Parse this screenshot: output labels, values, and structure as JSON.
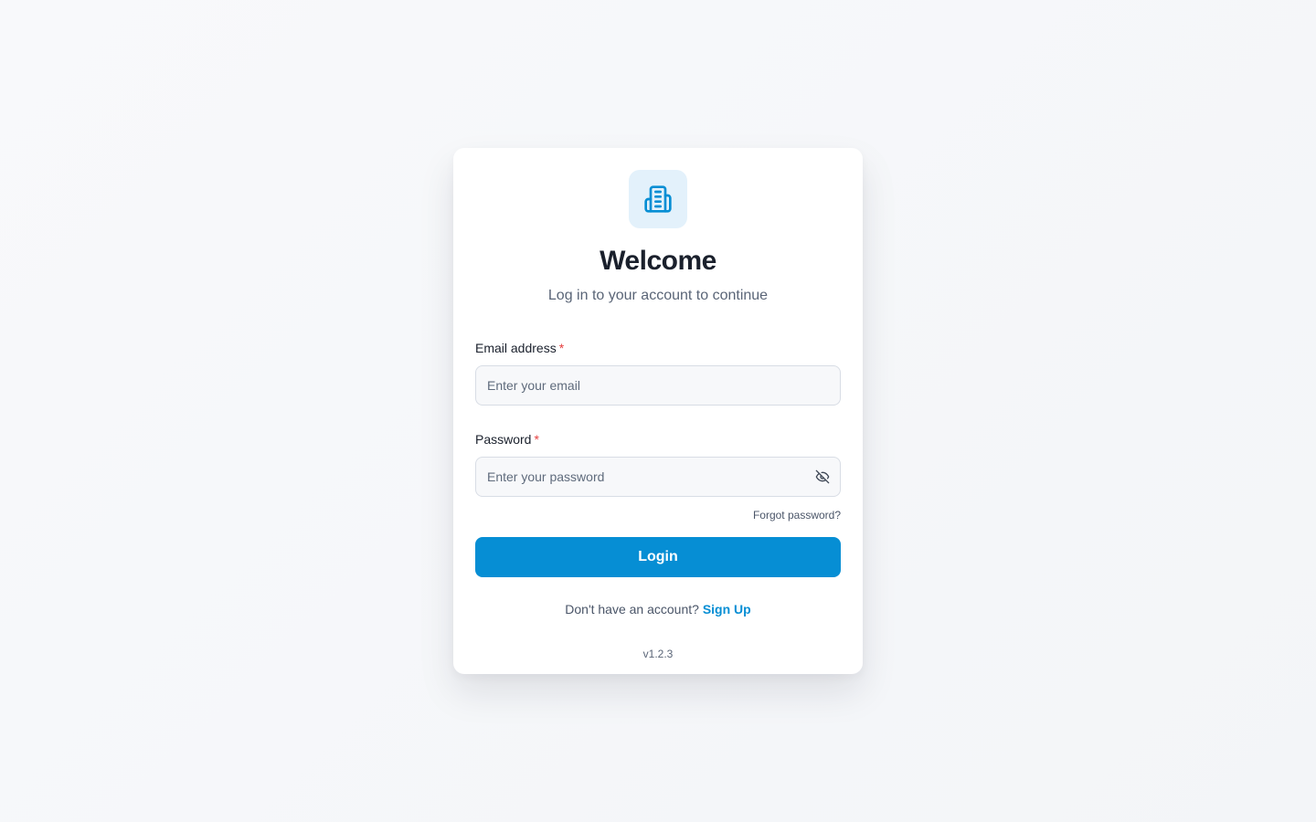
{
  "header": {
    "logo_icon": "building-icon",
    "title": "Welcome",
    "subtitle": "Log in to your account to continue"
  },
  "form": {
    "email": {
      "label": "Email address",
      "required_mark": "*",
      "value": "",
      "placeholder": "Enter your email"
    },
    "password": {
      "label": "Password",
      "required_mark": "*",
      "value": "",
      "placeholder": "Enter your password",
      "visibility_icon": "eye-off-icon"
    },
    "forgot_label": "Forgot password?",
    "submit_label": "Login"
  },
  "footer": {
    "signup_prompt": "Don't have an account?",
    "signup_label": "Sign Up",
    "version": "v1.2.3"
  },
  "colors": {
    "accent": "#068ed4",
    "logo_bg": "#e3f1fb",
    "required": "#e53e3e",
    "title": "#1a202c",
    "muted": "#5a6577"
  }
}
